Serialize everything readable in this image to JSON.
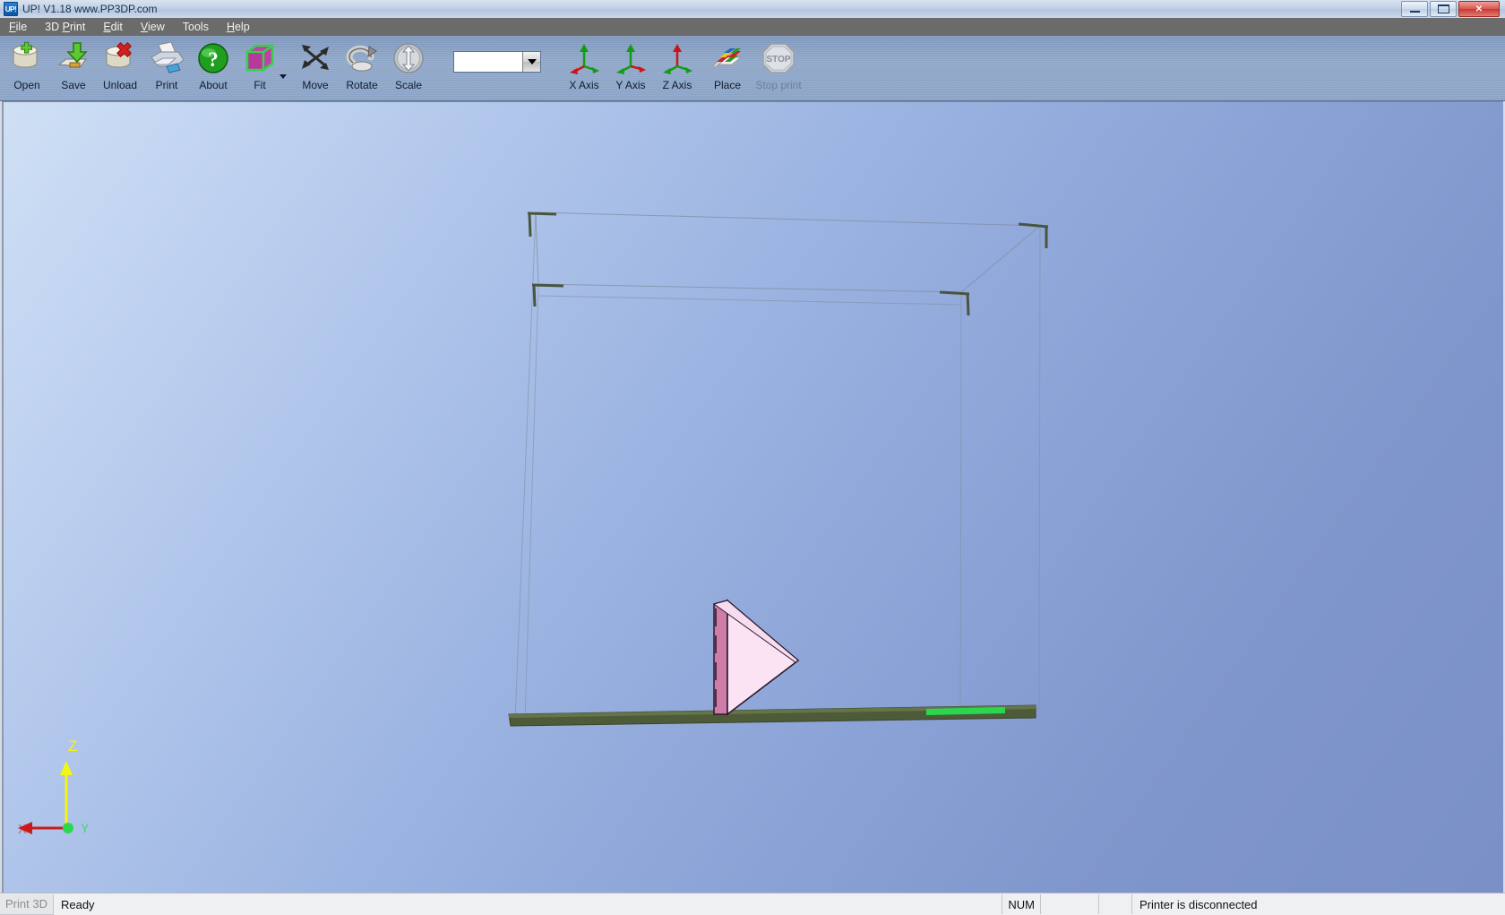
{
  "window": {
    "app_icon_label": "UP!",
    "title": "UP!  V1.18   www.PP3DP.com",
    "minimize_label": "Minimize",
    "restore_label": "Restore",
    "close_label": "✕"
  },
  "menubar": {
    "items": [
      {
        "label": "File",
        "accel": "F"
      },
      {
        "label": "3D Print",
        "accel": "P"
      },
      {
        "label": "Edit",
        "accel": "E"
      },
      {
        "label": "View",
        "accel": "V"
      },
      {
        "label": "Tools",
        "accel": ""
      },
      {
        "label": "Help",
        "accel": "H"
      }
    ]
  },
  "toolbar": {
    "buttons": [
      {
        "id": "open",
        "label": "Open",
        "icon": "open-file-icon",
        "enabled": true
      },
      {
        "id": "save",
        "label": "Save",
        "icon": "save-disk-icon",
        "enabled": true
      },
      {
        "id": "unload",
        "label": "Unload",
        "icon": "unload-x-icon",
        "enabled": true
      },
      {
        "id": "print",
        "label": "Print",
        "icon": "printer-icon",
        "enabled": true
      },
      {
        "id": "about",
        "label": "About",
        "icon": "question-icon",
        "enabled": true
      },
      {
        "id": "fit",
        "label": "Fit",
        "icon": "fit-cube-icon",
        "enabled": true,
        "has_dropdown": true
      },
      {
        "id": "move",
        "label": "Move",
        "icon": "move-arrows-icon",
        "enabled": true
      },
      {
        "id": "rotate",
        "label": "Rotate",
        "icon": "rotate-icon",
        "enabled": true
      },
      {
        "id": "scale",
        "label": "Scale",
        "icon": "scale-icon",
        "enabled": true
      }
    ],
    "combo": {
      "value": "",
      "placeholder": ""
    },
    "axis_buttons": [
      {
        "id": "x-axis",
        "label": "X Axis",
        "icon": "x-axis-gizmo-icon",
        "enabled": true
      },
      {
        "id": "y-axis",
        "label": "Y Axis",
        "icon": "y-axis-gizmo-icon",
        "enabled": true
      },
      {
        "id": "z-axis",
        "label": "Z Axis",
        "icon": "z-axis-gizmo-icon",
        "enabled": true
      }
    ],
    "place_button": {
      "id": "place",
      "label": "Place",
      "icon": "place-blocks-icon",
      "enabled": true
    },
    "stop_button": {
      "id": "stop-print",
      "label": "Stop print",
      "icon": "stop-sign-icon",
      "stop_text": "STOP",
      "enabled": false
    }
  },
  "viewport": {
    "axis_gizmo": {
      "z_label": "Z",
      "y_label": "Y",
      "x_label": "X",
      "z_color": "#f5f512",
      "x_color": "#cc1a1a",
      "y_color": "#1fc21f"
    },
    "model": {
      "name": "triangular-prism-model",
      "fill": "#fbe3f4",
      "edge": "#2a1a2e",
      "side_fill": "#d07ca8"
    },
    "platform": {
      "name": "build-platform",
      "fill": "#4c5a37",
      "highlight": "#2ad84f"
    },
    "build_volume": {
      "name": "build-volume-wireframe",
      "line_color": "#7f8a9d",
      "corner_color": "#46523a"
    },
    "background_top": "#cfe0f5",
    "background_bottom": "#7a90c6"
  },
  "statusbar": {
    "print_button_label": "Print 3D",
    "status_text": "Ready",
    "num_indicator": "NUM",
    "printer_status": "Printer is disconnected"
  }
}
